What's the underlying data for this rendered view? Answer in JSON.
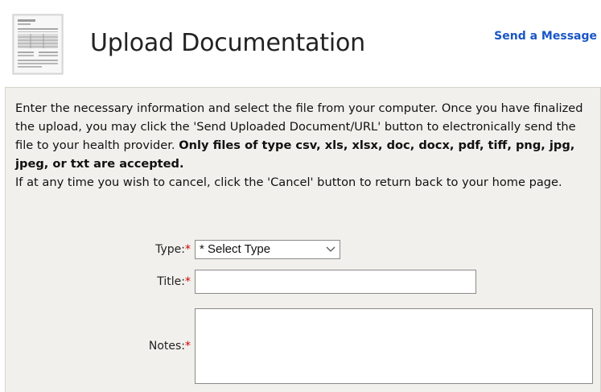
{
  "header": {
    "title": "Upload Documentation",
    "send_message_label": "Send a Message",
    "icon": "document-icon"
  },
  "intro": {
    "part1": "Enter the necessary information and select the file from your computer. Once you have finalized the upload, you may click the 'Send Uploaded Document/URL' button to electronically send the file to your health provider. ",
    "bold": "Only files of type csv, xls, xlsx, doc, docx, pdf, tiff, png, jpg, jpeg, or txt are accepted.",
    "part2": "If at any time you wish to cancel, click the 'Cancel' button to return back to your home page."
  },
  "form": {
    "type_label": "Type:",
    "type_value": "* Select Type",
    "title_label": "Title:",
    "title_value": "",
    "notes_label": "Notes:",
    "notes_value": "",
    "required_marker": "*"
  },
  "colors": {
    "link": "#1a56c4",
    "panel_bg": "#f2f0ec",
    "required": "#d00000"
  }
}
